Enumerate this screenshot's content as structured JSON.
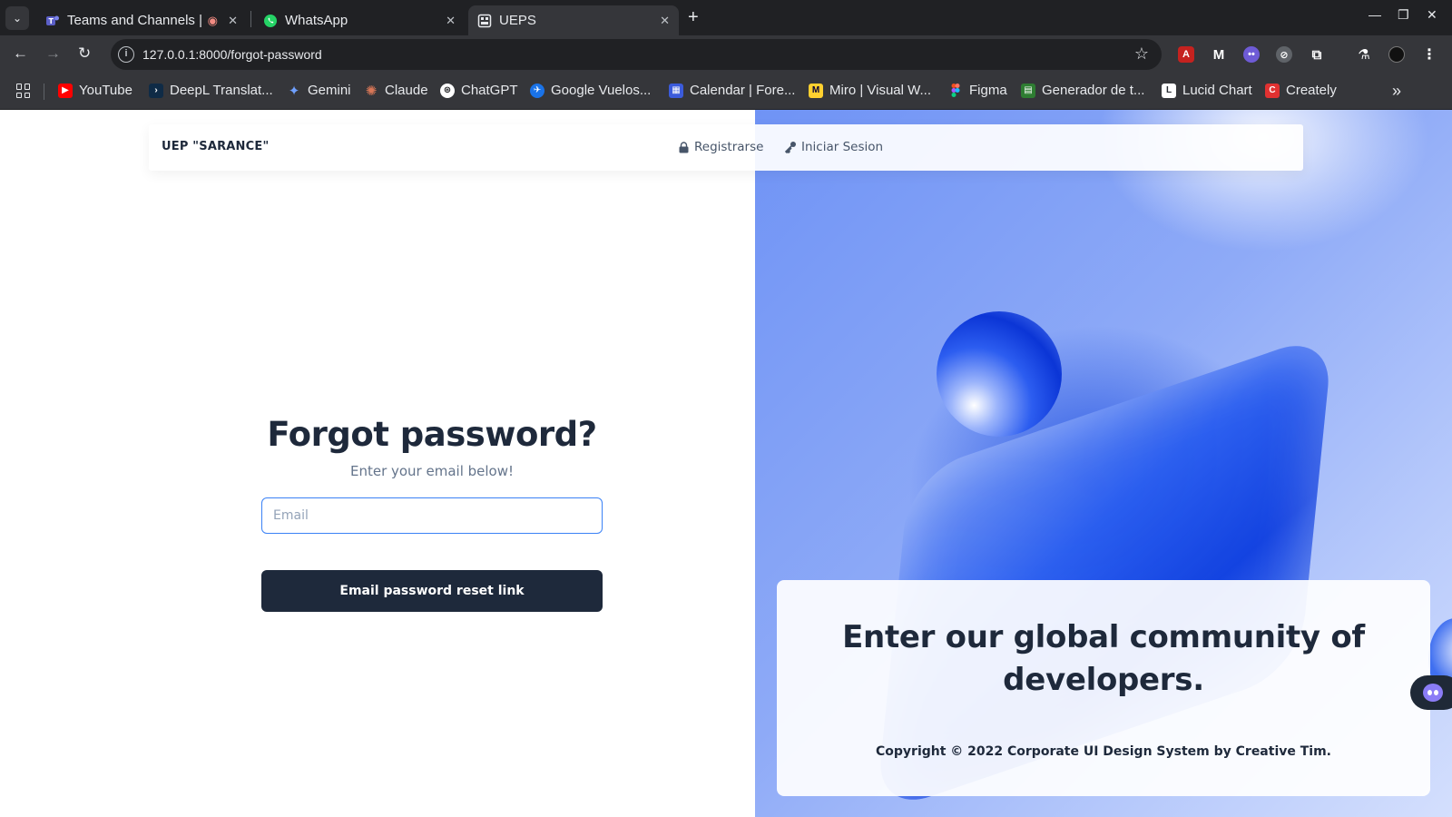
{
  "browser": {
    "tabs": [
      {
        "label": "Teams and Channels |",
        "icon": "teams-icon",
        "active": false
      },
      {
        "label": "WhatsApp",
        "icon": "whatsapp-icon",
        "active": false
      },
      {
        "label": "UEPS",
        "icon": "site-icon",
        "active": true
      }
    ],
    "url": "127.0.0.1:8000/forgot-password",
    "bookmarks": [
      {
        "label": "YouTube",
        "icon": "youtube-icon",
        "color": "#ff0000"
      },
      {
        "label": "DeepL Translat...",
        "icon": "deepl-icon",
        "color": "#0f2b46"
      },
      {
        "label": "Gemini",
        "icon": "gemini-icon",
        "color": "#4f8df7"
      },
      {
        "label": "Claude",
        "icon": "claude-icon",
        "color": "#d97757"
      },
      {
        "label": "ChatGPT",
        "icon": "chatgpt-icon",
        "color": "#ffffff"
      },
      {
        "label": "Google Vuelos...",
        "icon": "google-flights-icon",
        "color": "#1a73e8"
      },
      {
        "label": "Calendar | Fore...",
        "icon": "calendar-icon",
        "color": "#3b5bdb"
      },
      {
        "label": "Miro | Visual W...",
        "icon": "miro-icon",
        "color": "#ffd02f"
      },
      {
        "label": "Figma",
        "icon": "figma-icon",
        "color": "#f24e1e"
      },
      {
        "label": "Generador de t...",
        "icon": "generator-icon",
        "color": "#2e7d32"
      },
      {
        "label": "Lucid Chart",
        "icon": "lucidchart-icon",
        "color": "#282c33"
      },
      {
        "label": "Creately",
        "icon": "creately-icon",
        "color": "#e03131"
      }
    ]
  },
  "nav": {
    "brand": "UEP \"SARANCE\"",
    "register": "Registrarse",
    "login": "Iniciar Sesion"
  },
  "form": {
    "title": "Forgot password?",
    "subtitle": "Enter your email below!",
    "email_placeholder": "Email",
    "email_value": "",
    "submit_label": "Email password reset link"
  },
  "hero": {
    "card_title": "Enter our global community of developers.",
    "copyright": "Copyright © 2022 Corporate UI Design System by Creative Tim."
  },
  "colors": {
    "primary_dark": "#1e293b",
    "focus_blue": "#3b82f6",
    "hero_blue": "#2c5df0"
  }
}
